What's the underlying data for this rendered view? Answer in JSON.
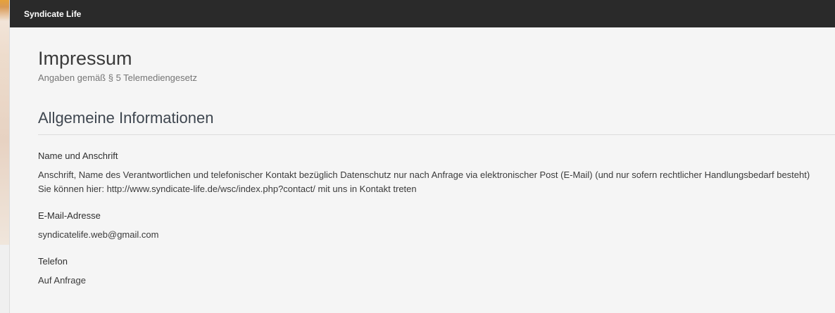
{
  "header": {
    "brand": "Syndicate Life"
  },
  "page": {
    "title": "Impressum",
    "subtitle": "Angaben gemäß § 5 Telemediengesetz"
  },
  "section": {
    "title": "Allgemeine Informationen",
    "fields": [
      {
        "label": "Name und Anschrift",
        "lines": [
          "Anschrift, Name des Verantwortlichen und telefonischer Kontakt bezüglich Datenschutz nur nach Anfrage via elektronischer Post (E-Mail) (und nur sofern rechtlicher Handlungsbedarf besteht)",
          "Sie können hier: http://www.syndicate-life.de/wsc/index.php?contact/ mit uns in Kontakt treten"
        ]
      },
      {
        "label": "E-Mail-Adresse",
        "lines": [
          "syndicatelife.web@gmail.com"
        ]
      },
      {
        "label": "Telefon",
        "lines": [
          "Auf Anfrage"
        ]
      }
    ]
  }
}
